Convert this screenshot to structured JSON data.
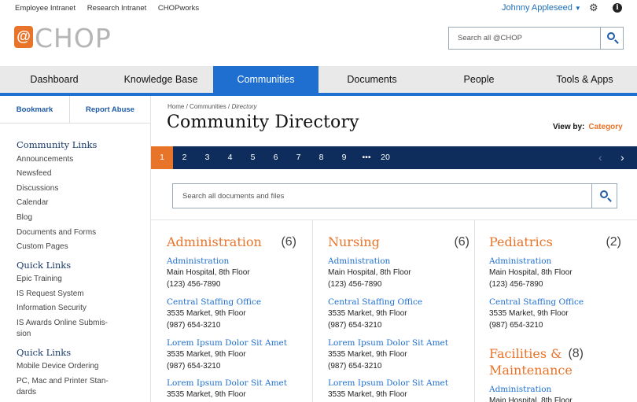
{
  "util_links": [
    "Employee Intranet",
    "Research Intranet",
    "CHOPworks"
  ],
  "user_name": "Johnny Appleseed",
  "logo": {
    "mark": "@",
    "text": "CHOP"
  },
  "header_search": {
    "placeholder": "Search all @CHOP"
  },
  "nav": [
    "Dashboard",
    "Knowledge Base",
    "Communities",
    "Documents",
    "People",
    "Tools & Apps"
  ],
  "nav_active": "Communities",
  "side_actions": {
    "bookmark": "Bookmark",
    "report": "Report Abuse"
  },
  "sidebar": {
    "community_links": {
      "title": "Community Links",
      "items": [
        "Announcements",
        "Newsfeed",
        "Discussions",
        "Calendar",
        "Blog",
        "Documents and Forms",
        "Custom Pages"
      ]
    },
    "quick_links_1": {
      "title": "Quick Links",
      "items": [
        "Epic Training",
        "IS Request System",
        "Information Security",
        "IS Awards Online Submis-sion"
      ]
    },
    "quick_links_2": {
      "title": "Quick Links",
      "items": [
        "Mobile Device Ordering",
        "PC, Mac and Printer Stan-dards"
      ]
    }
  },
  "breadcrumb": {
    "home": "Home",
    "sep": "/",
    "communities": "Communities",
    "current": "Directory"
  },
  "page_title": "Community Directory",
  "view_by": {
    "label": "View by:",
    "value": "Category"
  },
  "pager": {
    "pages": [
      "1",
      "2",
      "3",
      "4",
      "5",
      "6",
      "7",
      "8",
      "9",
      "•••",
      "20"
    ],
    "active": "1",
    "prev": "‹",
    "next": "›"
  },
  "main_search": {
    "placeholder": "Search all documents and files"
  },
  "departments": [
    {
      "title": "Administration",
      "count": "(6)",
      "entries": [
        {
          "name": "Administration",
          "address": "Main Hospital, 8th Floor",
          "phone": "(123) 456-7890"
        },
        {
          "name": "Central Staffing Office",
          "address": "3535 Market, 9th Floor",
          "phone": "(987) 654-3210"
        },
        {
          "name": "Lorem Ipsum Dolor Sit Amet",
          "address": "3535 Market, 9th Floor",
          "phone": "(987) 654-3210"
        },
        {
          "name": "Lorem Ipsum Dolor Sit Amet",
          "address": "3535 Market, 9th Floor",
          "phone": ""
        }
      ]
    },
    {
      "title": "Nursing",
      "count": "(6)",
      "entries": [
        {
          "name": "Administration",
          "address": "Main Hospital, 8th Floor",
          "phone": "(123) 456-7890"
        },
        {
          "name": "Central Staffing Office",
          "address": "3535 Market, 9th Floor",
          "phone": "(987) 654-3210"
        },
        {
          "name": "Lorem Ipsum Dolor Sit Amet",
          "address": "3535 Market, 9th Floor",
          "phone": "(987) 654-3210"
        },
        {
          "name": "Lorem Ipsum Dolor Sit Amet",
          "address": "3535 Market, 9th Floor",
          "phone": ""
        }
      ]
    },
    {
      "title": "Pediatrics",
      "count": "(2)",
      "entries": [
        {
          "name": "Administration",
          "address": "Main Hospital, 8th Floor",
          "phone": "(123) 456-7890"
        },
        {
          "name": "Central Staffing Office",
          "address": "3535 Market, 9th Floor",
          "phone": "(987) 654-3210"
        }
      ]
    },
    {
      "title": "Facilities & Maintenance",
      "count": "(8)",
      "entries": [
        {
          "name": "Administration",
          "address": "Main Hospital, 8th Floor",
          "phone": ""
        }
      ]
    }
  ],
  "colors": {
    "accent_orange": "#e8742a",
    "nav_blue": "#1e6fd0",
    "pager_navy": "#0f2d5c",
    "link_blue": "#1e6fd0"
  },
  "icons": {
    "user_menu": "chevron-down-icon",
    "settings": "gear-icon",
    "info": "info-icon",
    "search": "search-icon"
  }
}
